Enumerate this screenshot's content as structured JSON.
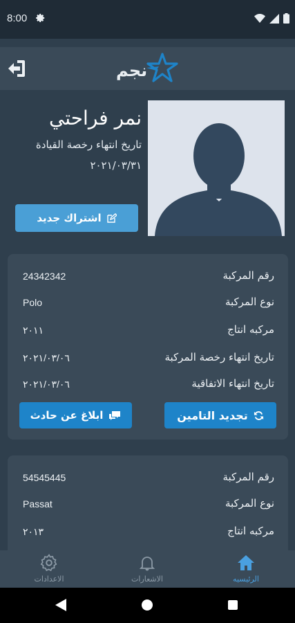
{
  "status_bar": {
    "time": "8:00",
    "settings_icon": "gear-icon",
    "wifi_icon": "wifi-icon",
    "signal_icon": "signal-icon",
    "battery_icon": "battery-icon"
  },
  "app_bar": {
    "logo_text": "نجم",
    "logout_icon": "logout-icon"
  },
  "profile": {
    "name": "نمر فراحتي",
    "license_label": "تاريخ انتهاء رخصة القيادة",
    "license_date": "٢٠٢١/٠٣/٣١",
    "subscribe_label": "اشتراك جديد"
  },
  "vehicles": [
    {
      "rows": [
        {
          "label": "رقم المركبة",
          "value": "24342342"
        },
        {
          "label": "نوع المركبة",
          "value": "Polo"
        },
        {
          "label": "مركبه انتاج",
          "value": "٢٠١١"
        },
        {
          "label": "تاريخ انتهاء رخصة المركبة",
          "value": "٢٠٢١/٠٣/٠٦"
        },
        {
          "label": "تاريخ انتهاء الاتفاقية",
          "value": "٢٠٢١/٠٣/٠٦"
        }
      ],
      "renew_label": "تجديد التامين",
      "report_label": "ابلاغ عن حادث"
    },
    {
      "rows": [
        {
          "label": "رقم المركبة",
          "value": "54545445"
        },
        {
          "label": "نوع المركبة",
          "value": "Passat"
        },
        {
          "label": "مركبه انتاج",
          "value": "٢٠١٣"
        }
      ]
    }
  ],
  "bottom_nav": [
    {
      "label": "الرئيسيه",
      "icon": "home-icon",
      "active": true
    },
    {
      "label": "الاشعارات",
      "icon": "bell-icon",
      "active": false
    },
    {
      "label": "الاعدادات",
      "icon": "settings-icon",
      "active": false
    }
  ],
  "colors": {
    "background": "#2f3f4d",
    "card": "#3a4a58",
    "primary_button": "#1e84c9",
    "secondary_button": "#4a9fd6",
    "active_nav": "#4aa0e0"
  }
}
